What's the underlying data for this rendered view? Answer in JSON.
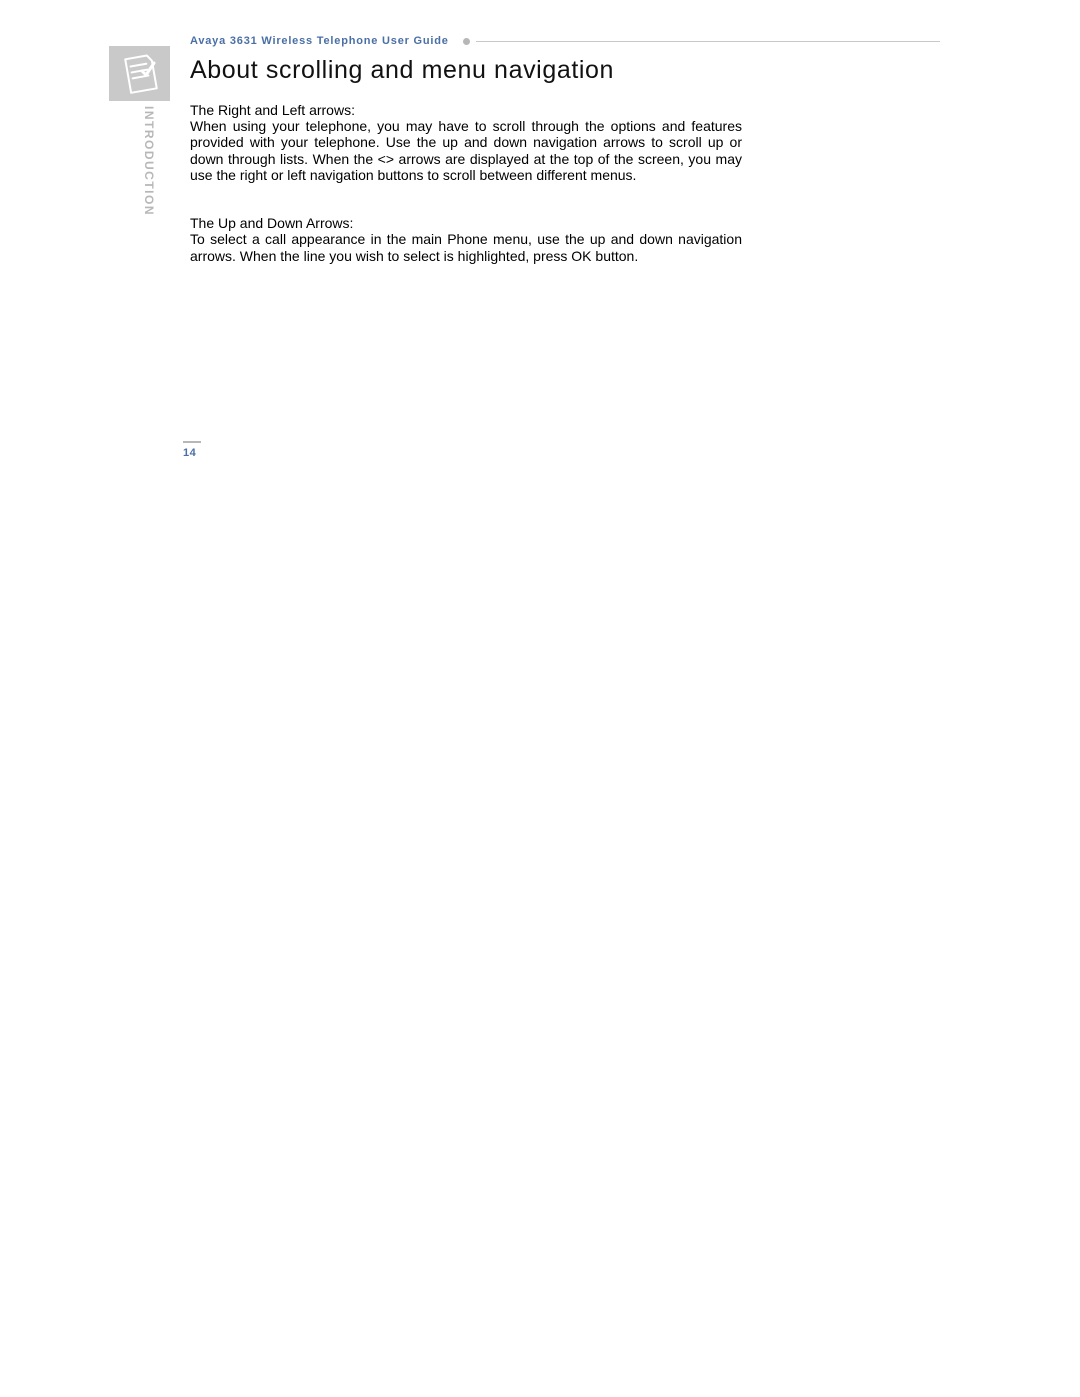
{
  "header": {
    "guide_title": "Avaya 3631 Wireless Telephone User Guide"
  },
  "section": {
    "label": "INTRODUCTION",
    "icon_name": "note-checklist-icon"
  },
  "title": "About scrolling and menu navigation",
  "body": {
    "p1_label": "The Right and Left arrows:",
    "p1": "When using your telephone, you may have to scroll through the options and features provided with your telephone. Use the up and down navigation arrows to scroll up or down through lists. When the <> arrows are displayed at the top of the screen, you may use the right or left navigation buttons to scroll between different menus.",
    "p2_label": "The Up and Down Arrows:",
    "p2": "To select a call appearance in the main Phone menu, use the up and down navigation arrows. When the line you wish to select is highlighted, press OK button."
  },
  "page_number": "14"
}
